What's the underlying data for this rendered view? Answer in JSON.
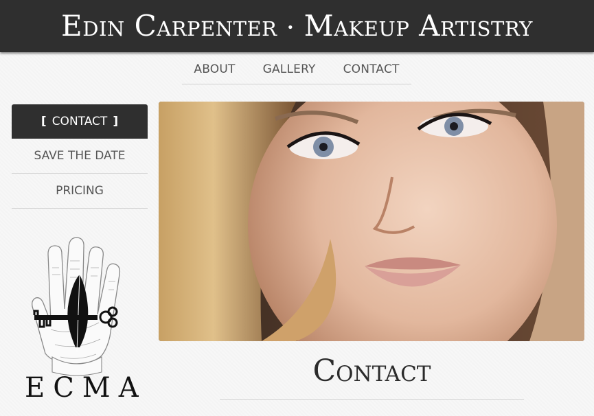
{
  "header": {
    "name": "Edin Carpenter",
    "separator": "•",
    "tagline": "Makeup Artistry"
  },
  "nav": {
    "items": [
      {
        "label": "ABOUT"
      },
      {
        "label": "GALLERY"
      },
      {
        "label": "CONTACT"
      }
    ]
  },
  "sidebar": {
    "active": {
      "label": "CONTACT",
      "open_bracket": "[",
      "close_bracket": "]"
    },
    "items": [
      {
        "label": "SAVE THE DATE"
      },
      {
        "label": "PRICING"
      }
    ]
  },
  "logo": {
    "text": "ECMA"
  },
  "main": {
    "heading": "Contact"
  }
}
